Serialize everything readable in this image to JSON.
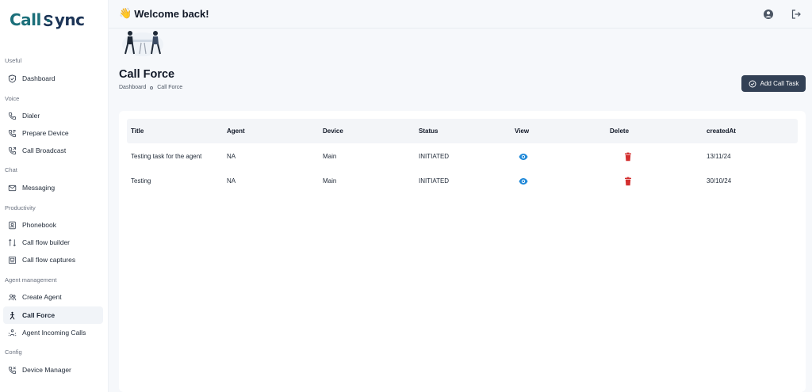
{
  "app": {
    "logo_part1": "Call",
    "logo_part2": "ync"
  },
  "sidebar": {
    "sections": [
      {
        "label": "Useful"
      },
      {
        "label": "Voice"
      },
      {
        "label": "Chat"
      },
      {
        "label": "Productivity"
      },
      {
        "label": "Agent management"
      },
      {
        "label": "Config"
      }
    ],
    "items": [
      {
        "label": "Dashboard",
        "icon": "shield-check-icon"
      },
      {
        "label": "Dialer",
        "icon": "phone-icon"
      },
      {
        "label": "Prepare Device",
        "icon": "phone-config-icon"
      },
      {
        "label": "Call Broadcast",
        "icon": "phone-broadcast-icon"
      },
      {
        "label": "Messaging",
        "icon": "mail-icon"
      },
      {
        "label": "Phonebook",
        "icon": "phonebook-icon"
      },
      {
        "label": "Call flow builder",
        "icon": "flow-icon"
      },
      {
        "label": "Call flow captures",
        "icon": "capture-icon"
      },
      {
        "label": "Create Agent",
        "icon": "agents-icon"
      },
      {
        "label": "Call Force",
        "icon": "person-force-icon",
        "active": true
      },
      {
        "label": "Agent Incoming Calls",
        "icon": "incoming-icon"
      },
      {
        "label": "Device Manager",
        "icon": "phone-device-icon"
      }
    ]
  },
  "header": {
    "welcome": "Welcome back!",
    "wave_emoji": "👋"
  },
  "page": {
    "title": "Call Force",
    "breadcrumb": [
      "Dashboard",
      "Call Force"
    ],
    "add_button": "Add Call Task"
  },
  "table": {
    "columns": [
      "Title",
      "Agent",
      "Device",
      "Status",
      "View",
      "Delete",
      "createdAt"
    ],
    "rows": [
      {
        "title": "Testing task for the agent",
        "agent": "NA",
        "device": "Main",
        "status": "INITIATED",
        "created": "13/11/24"
      },
      {
        "title": "Testing",
        "agent": "NA",
        "device": "Main",
        "status": "INITIATED",
        "created": "30/10/24"
      }
    ]
  },
  "colors": {
    "brand_teal": "#1b6f7a",
    "brand_navy": "#1d3557",
    "primary_button": "#334155",
    "view_icon": "#1f88d8",
    "delete_icon": "#d32f2f"
  }
}
